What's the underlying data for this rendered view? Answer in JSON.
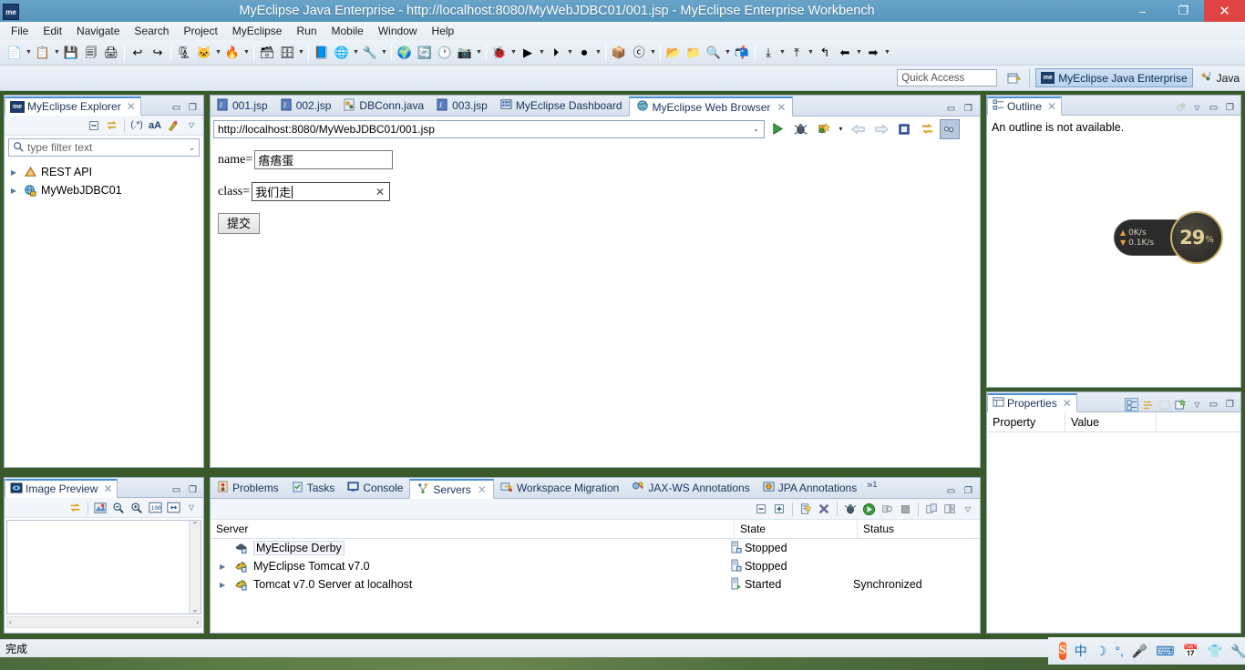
{
  "window": {
    "title": "MyEclipse Java Enterprise - http://localhost:8080/MyWebJDBC01/001.jsp - MyEclipse Enterprise Workbench",
    "app_badge": "me",
    "minimize": "–",
    "restore": "❐",
    "close": "✕"
  },
  "menubar": {
    "items": [
      "File",
      "Edit",
      "Navigate",
      "Search",
      "Project",
      "MyEclipse",
      "Run",
      "Mobile",
      "Window",
      "Help"
    ]
  },
  "perspective": {
    "quick_access_placeholder": "Quick Access",
    "open_perspective_icon": "open-perspective-icon",
    "active": {
      "badge": "me",
      "label": "MyEclipse Java Enterprise"
    },
    "other": {
      "label": "Java"
    }
  },
  "explorer": {
    "tab_title": "MyEclipse Explorer",
    "tab_icon": "me",
    "close": "✕",
    "minimize": "▭",
    "maximize": "❐",
    "toolbar": [
      "collapse-all-icon",
      "link-with-editor-icon",
      "regex-filter-icon",
      "case-sensitive-icon",
      "customize-icon",
      "view-menu-icon"
    ],
    "filter_placeholder": "type filter text",
    "tree": [
      {
        "label": "REST API",
        "icon": "rest-api-icon",
        "expandable": true
      },
      {
        "label": "MyWebJDBC01",
        "icon": "web-project-icon",
        "expandable": true
      }
    ]
  },
  "image_preview": {
    "tab_title": "Image Preview",
    "close": "✕",
    "toolbar": [
      "sync-icon",
      "palette-icon",
      "zoom-out-icon",
      "zoom-in-icon",
      "zoom-100-icon",
      "fit-page-icon",
      "view-menu-icon"
    ]
  },
  "editor": {
    "tabs": [
      {
        "label": "001.jsp",
        "icon": "jsp-file-icon",
        "active": false,
        "closable": false
      },
      {
        "label": "002.jsp",
        "icon": "jsp-file-icon",
        "active": false,
        "closable": false
      },
      {
        "label": "DBConn.java",
        "icon": "java-file-icon",
        "active": false,
        "closable": false
      },
      {
        "label": "003.jsp",
        "icon": "jsp-file-icon",
        "active": false,
        "closable": false
      },
      {
        "label": "MyEclipse Dashboard",
        "icon": "dashboard-icon",
        "active": false,
        "closable": false
      },
      {
        "label": "MyEclipse Web Browser",
        "icon": "globe-icon",
        "active": true,
        "closable": true
      }
    ],
    "minimize": "▭",
    "maximize": "❐"
  },
  "browser": {
    "url": "http://localhost:8080/MyWebJDBC01/001.jsp",
    "dropdown": "⌄",
    "buttons": [
      "go-icon",
      "debug-icon",
      "run-as-icon",
      "run-as-dropdown",
      "back-icon",
      "forward-icon",
      "stop-icon",
      "refresh-icon",
      "open-external-browser-icon"
    ],
    "page": {
      "fields": [
        {
          "label": "name=",
          "value": "痦痦蛋",
          "focused": false,
          "has_clear": false
        },
        {
          "label": "class=",
          "value": "我们走",
          "focused": true,
          "has_clear": true,
          "clear_glyph": "✕"
        }
      ],
      "submit_label": "提交"
    }
  },
  "outline": {
    "tab_title": "Outline",
    "close": "✕",
    "message": "An outline is not available.",
    "toolbar": [
      "focus-icon",
      "view-menu-icon",
      "minimize-icon",
      "maximize-icon"
    ]
  },
  "properties": {
    "tab_title": "Properties",
    "close": "✕",
    "toolbar": [
      "show-categories-icon",
      "show-advanced-icon",
      "restore-default-icon",
      "new-tab-icon",
      "view-menu-icon",
      "minimize-icon",
      "maximize-icon"
    ],
    "columns": [
      "Property",
      "Value"
    ],
    "rows": []
  },
  "bottom_panel": {
    "tabs": [
      {
        "label": "Problems",
        "icon": "problems-icon",
        "active": false,
        "closable": false
      },
      {
        "label": "Tasks",
        "icon": "tasks-icon",
        "active": false,
        "closable": false
      },
      {
        "label": "Console",
        "icon": "console-icon",
        "active": false,
        "closable": false
      },
      {
        "label": "Servers",
        "icon": "servers-icon",
        "active": true,
        "closable": true
      },
      {
        "label": "Workspace Migration",
        "icon": "migration-icon",
        "active": false,
        "closable": false
      },
      {
        "label": "JAX-WS Annotations",
        "icon": "jaxws-icon",
        "active": false,
        "closable": false
      },
      {
        "label": "JPA Annotations",
        "icon": "jpa-icon",
        "active": false,
        "closable": false
      }
    ],
    "overflow_indicator": "»",
    "overflow_count": "1",
    "toolbar": [
      "collapse-all-icon",
      "expand-all-icon",
      "new-server-icon",
      "delete-server-icon",
      "debug-server-icon",
      "start-server-icon",
      "profile-server-icon",
      "stop-server-icon",
      "publish-icon",
      "publish-clean-icon",
      "view-menu-icon"
    ],
    "columns": [
      "Server",
      "State",
      "Status"
    ],
    "rows": [
      {
        "server": "MyEclipse Derby",
        "icon": "derby-icon",
        "expandable": false,
        "selected": true,
        "state": "Stopped",
        "state_icon": "stopped-icon",
        "status": ""
      },
      {
        "server": "MyEclipse Tomcat v7.0",
        "icon": "tomcat-icon",
        "expandable": true,
        "selected": false,
        "state": "Stopped",
        "state_icon": "stopped-icon",
        "status": ""
      },
      {
        "server": "Tomcat v7.0 Server at localhost",
        "icon": "tomcat-icon",
        "expandable": true,
        "selected": false,
        "state": "Started",
        "state_icon": "started-icon",
        "status": "Synchronized"
      }
    ]
  },
  "statusbar": {
    "text": "完成",
    "resize_dots": "⋮"
  },
  "net_widget": {
    "upload": "0K/s",
    "download": "0.1K/s",
    "cpu_value": "29",
    "cpu_unit": "%",
    "up_arrow": "▲",
    "down_arrow": "▼"
  },
  "tray": {
    "items": [
      {
        "name": "sogou-logo-icon",
        "glyph": "S"
      },
      {
        "name": "input-mode-chinese-icon",
        "glyph": "中"
      },
      {
        "name": "moon-icon",
        "glyph": "☽"
      },
      {
        "name": "punctuation-icon",
        "glyph": "°,"
      },
      {
        "name": "voice-input-icon",
        "glyph": "🎤"
      },
      {
        "name": "soft-keyboard-icon",
        "glyph": "⌨"
      },
      {
        "name": "calendar-icon",
        "glyph": "📅"
      },
      {
        "name": "skin-icon",
        "glyph": "👕"
      },
      {
        "name": "toolbox-icon",
        "glyph": "🔧"
      }
    ]
  },
  "toolbar": {
    "groups": [
      {
        "icons": [
          {
            "name": "new-icon",
            "glyph": "📄",
            "arrow": true
          },
          {
            "name": "new-wizard-icon",
            "glyph": "📋",
            "arrow": true
          },
          {
            "name": "save-icon",
            "glyph": "💾",
            "arrow": false
          },
          {
            "name": "save-all-icon",
            "glyph": "🗐",
            "arrow": false
          },
          {
            "name": "print-icon",
            "glyph": "🖨",
            "arrow": false
          }
        ]
      },
      {
        "icons": [
          {
            "name": "undo-icon",
            "glyph": "↩",
            "arrow": false
          },
          {
            "name": "redo-icon",
            "glyph": "↪",
            "arrow": false
          }
        ]
      },
      {
        "icons": [
          {
            "name": "deploy-icon",
            "glyph": "🗜",
            "arrow": false
          },
          {
            "name": "run-tomcat-icon",
            "glyph": "🐱",
            "arrow": true
          },
          {
            "name": "myeclipse-servers-icon",
            "glyph": "🔥",
            "arrow": true
          }
        ]
      },
      {
        "icons": [
          {
            "name": "database-explorer-icon",
            "glyph": "🗃",
            "arrow": false
          },
          {
            "name": "new-database-icon",
            "glyph": "🗄",
            "arrow": true
          }
        ]
      },
      {
        "icons": [
          {
            "name": "ee-project-icon",
            "glyph": "📘",
            "arrow": false
          },
          {
            "name": "web-project-icon",
            "glyph": "🌐",
            "arrow": true
          },
          {
            "name": "web-service-icon",
            "glyph": "🔧",
            "arrow": true
          }
        ]
      },
      {
        "icons": [
          {
            "name": "open-browser-icon",
            "glyph": "🌍",
            "arrow": false
          },
          {
            "name": "refresh-icon",
            "glyph": "🔄",
            "arrow": false
          },
          {
            "name": "history-icon",
            "glyph": "🕐",
            "arrow": false
          },
          {
            "name": "snapshot-icon",
            "glyph": "📷",
            "arrow": true
          }
        ]
      },
      {
        "icons": [
          {
            "name": "debug-icon",
            "glyph": "🐞",
            "arrow": true
          },
          {
            "name": "run-icon",
            "glyph": "▶",
            "arrow": true
          },
          {
            "name": "run-last-icon",
            "glyph": "⏵",
            "arrow": true
          },
          {
            "name": "coverage-icon",
            "glyph": "⏺",
            "arrow": true
          }
        ]
      },
      {
        "icons": [
          {
            "name": "new-java-package-icon",
            "glyph": "📦",
            "arrow": false
          },
          {
            "name": "new-java-class-icon",
            "glyph": "ⓒ",
            "arrow": true
          }
        ]
      },
      {
        "icons": [
          {
            "name": "open-type-icon",
            "glyph": "📂",
            "arrow": false
          },
          {
            "name": "open-resource-icon",
            "glyph": "📁",
            "arrow": false
          },
          {
            "name": "search-icon",
            "glyph": "🔍",
            "arrow": true
          },
          {
            "name": "open-task-icon",
            "glyph": "📬",
            "arrow": false
          }
        ]
      },
      {
        "icons": [
          {
            "name": "next-annotation-icon",
            "glyph": "⤓",
            "arrow": true
          },
          {
            "name": "previous-annotation-icon",
            "glyph": "⤒",
            "arrow": true
          },
          {
            "name": "last-edit-icon",
            "glyph": "↰",
            "arrow": false
          },
          {
            "name": "back-icon",
            "glyph": "⬅",
            "arrow": true
          },
          {
            "name": "forward-icon",
            "glyph": "➡",
            "arrow": true
          }
        ]
      }
    ]
  }
}
